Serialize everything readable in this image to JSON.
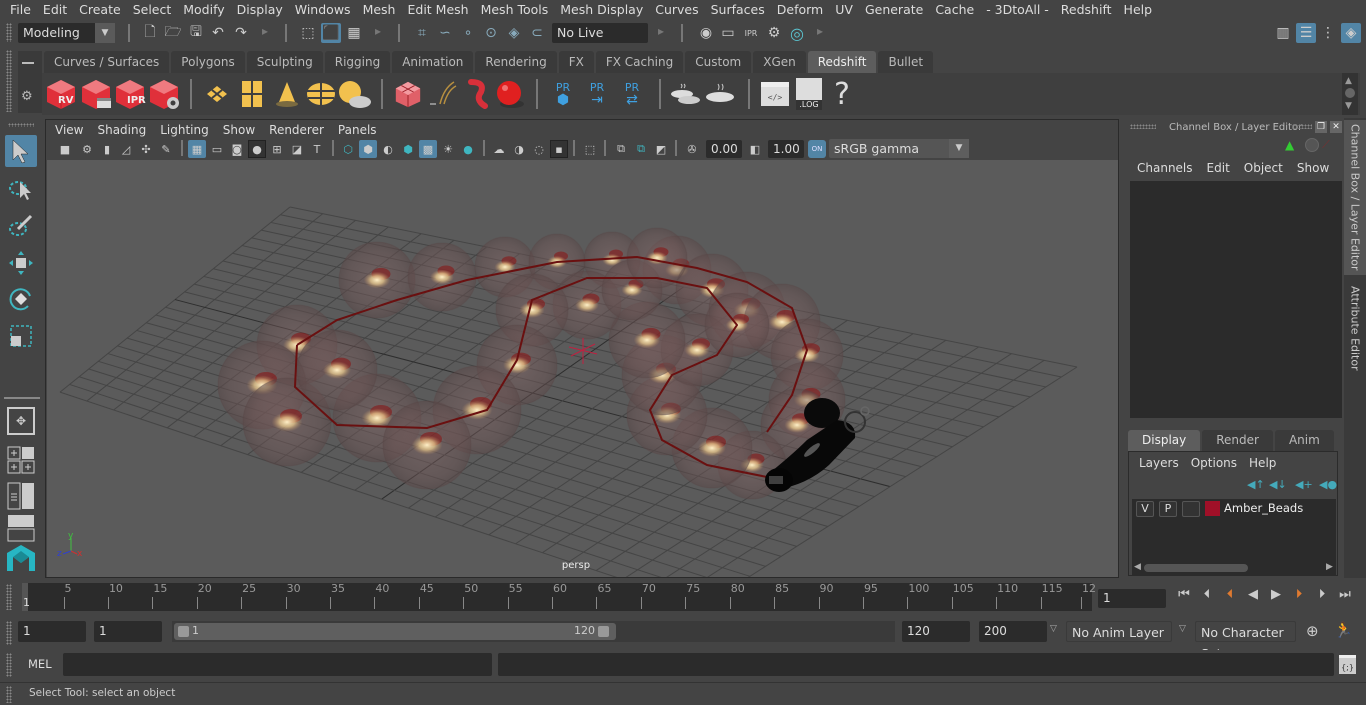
{
  "menubar": {
    "items": [
      "File",
      "Edit",
      "Create",
      "Select",
      "Modify",
      "Display",
      "Windows",
      "Mesh",
      "Edit Mesh",
      "Mesh Tools",
      "Mesh Display",
      "Curves",
      "Surfaces",
      "Deform",
      "UV",
      "Generate",
      "Cache",
      "- 3DtoAll -",
      "Redshift",
      "Help"
    ]
  },
  "statusline": {
    "workspace": "Modeling",
    "live_surface": "No Live Surface",
    "icons": [
      "new-scene-icon",
      "open-scene-icon",
      "save-scene-icon",
      "undo-icon",
      "redo-icon",
      "select-by-hierarchy-icon",
      "select-by-object-icon",
      "select-by-component-icon",
      "snap-grid-icon",
      "snap-curve-icon",
      "snap-point-icon",
      "snap-view-plane-icon",
      "snap-surface-icon",
      "make-live-icon",
      "render-view-icon",
      "render-frame-icon",
      "ipr-render-icon",
      "render-settings-icon",
      "hypershade-icon"
    ],
    "right_icons": [
      "modeling-toolkit-icon",
      "attribute-editor-toggle-icon",
      "tool-settings-icon",
      "channel-box-toggle-icon"
    ]
  },
  "shelf": {
    "tabs": [
      {
        "label": "Curves / Surfaces",
        "active": false
      },
      {
        "label": "Polygons",
        "active": false
      },
      {
        "label": "Sculpting",
        "active": false
      },
      {
        "label": "Rigging",
        "active": false
      },
      {
        "label": "Animation",
        "active": false
      },
      {
        "label": "Rendering",
        "active": false
      },
      {
        "label": "FX",
        "active": false
      },
      {
        "label": "FX Caching",
        "active": false
      },
      {
        "label": "Custom",
        "active": false
      },
      {
        "label": "XGen",
        "active": false
      },
      {
        "label": "Redshift",
        "active": true
      },
      {
        "label": "Bullet",
        "active": false
      }
    ],
    "buttons": [
      {
        "name": "redshift-render-view-icon",
        "label": "RV"
      },
      {
        "name": "redshift-batch-render-icon",
        "label": ""
      },
      {
        "name": "redshift-ipr-icon",
        "label": "IPR"
      },
      {
        "name": "redshift-render-settings-icon",
        "label": ""
      },
      {
        "name": "redshift-area-light-icon",
        "label": ""
      },
      {
        "name": "redshift-portal-light-icon",
        "label": ""
      },
      {
        "name": "redshift-ies-light-icon",
        "label": ""
      },
      {
        "name": "redshift-dome-light-icon",
        "label": ""
      },
      {
        "name": "redshift-sun-sky-icon",
        "label": ""
      },
      {
        "name": "redshift-proxy-icon",
        "label": ""
      },
      {
        "name": "redshift-physical-light-icon",
        "label": ""
      },
      {
        "name": "redshift-volume-icon",
        "label": ""
      },
      {
        "name": "redshift-material-ball-icon",
        "label": ""
      },
      {
        "name": "redshift-proxy-create-icon",
        "label": "PR"
      },
      {
        "name": "redshift-proxy-export-icon",
        "label": "PR"
      },
      {
        "name": "redshift-proxy-convert-icon",
        "label": "PR"
      },
      {
        "name": "redshift-bake-multiple-icon",
        "label": ""
      },
      {
        "name": "redshift-bake-icon",
        "label": ""
      },
      {
        "name": "redshift-script-editor-icon",
        "label": ""
      },
      {
        "name": "redshift-log-icon",
        "label": ".LOG"
      },
      {
        "name": "redshift-help-icon",
        "label": "?"
      }
    ]
  },
  "toolbox": {
    "tools": [
      "select-tool-icon",
      "lasso-tool-icon",
      "paint-select-tool-icon",
      "move-tool-icon",
      "rotate-tool-icon",
      "scale-tool-icon"
    ],
    "layouts": [
      "single-perspective-layout-icon",
      "four-view-layout-icon",
      "persp-outliner-layout-icon",
      "persp-graph-layout-icon"
    ]
  },
  "viewport": {
    "menu": [
      "View",
      "Shading",
      "Lighting",
      "Show",
      "Renderer",
      "Panels"
    ],
    "exposure": "0.00",
    "gamma": "1.00",
    "color_management_toggle": "ON",
    "view_transform": "sRGB gamma",
    "camera_label": "persp",
    "axis": {
      "x": "x",
      "y": "y",
      "z": "z"
    }
  },
  "channel_box": {
    "title": "Channel Box / Layer Editor",
    "menu": [
      "Channels",
      "Edit",
      "Object",
      "Show"
    ]
  },
  "layer_editor": {
    "tabs": [
      {
        "label": "Display",
        "active": true
      },
      {
        "label": "Render",
        "active": false
      },
      {
        "label": "Anim",
        "active": false
      }
    ],
    "menu": [
      "Layers",
      "Options",
      "Help"
    ],
    "layers": [
      {
        "visible": "V",
        "playback": "P",
        "name": "Amber_Beads",
        "color": "#a01028"
      }
    ]
  },
  "side_tabs": [
    "Channel Box / Layer Editor",
    "Attribute Editor"
  ],
  "timeline": {
    "current_frame_marker": "1",
    "ticks": [
      5,
      10,
      15,
      20,
      25,
      30,
      35,
      40,
      45,
      50,
      55,
      60,
      65,
      70,
      75,
      80,
      85,
      90,
      95,
      100,
      105,
      110,
      115,
      "12"
    ],
    "start": 1,
    "end": 120,
    "current_frame_field": "1"
  },
  "range": {
    "start_field": "1",
    "playback_start": "1",
    "slider_start": "1",
    "slider_end": "120",
    "playback_end": "120",
    "end_field": "200",
    "anim_layer": "No Anim Layer",
    "character_set": "No Character Set"
  },
  "command_line": {
    "label": "MEL",
    "value": "",
    "result": ""
  },
  "help_line": {
    "text": "Select Tool: select an object"
  },
  "colors": {
    "accent_blue": "#5285a6",
    "redshift_red": "#e0303a",
    "layer_color": "#a01028",
    "maya_teal": "#27b6c3"
  }
}
